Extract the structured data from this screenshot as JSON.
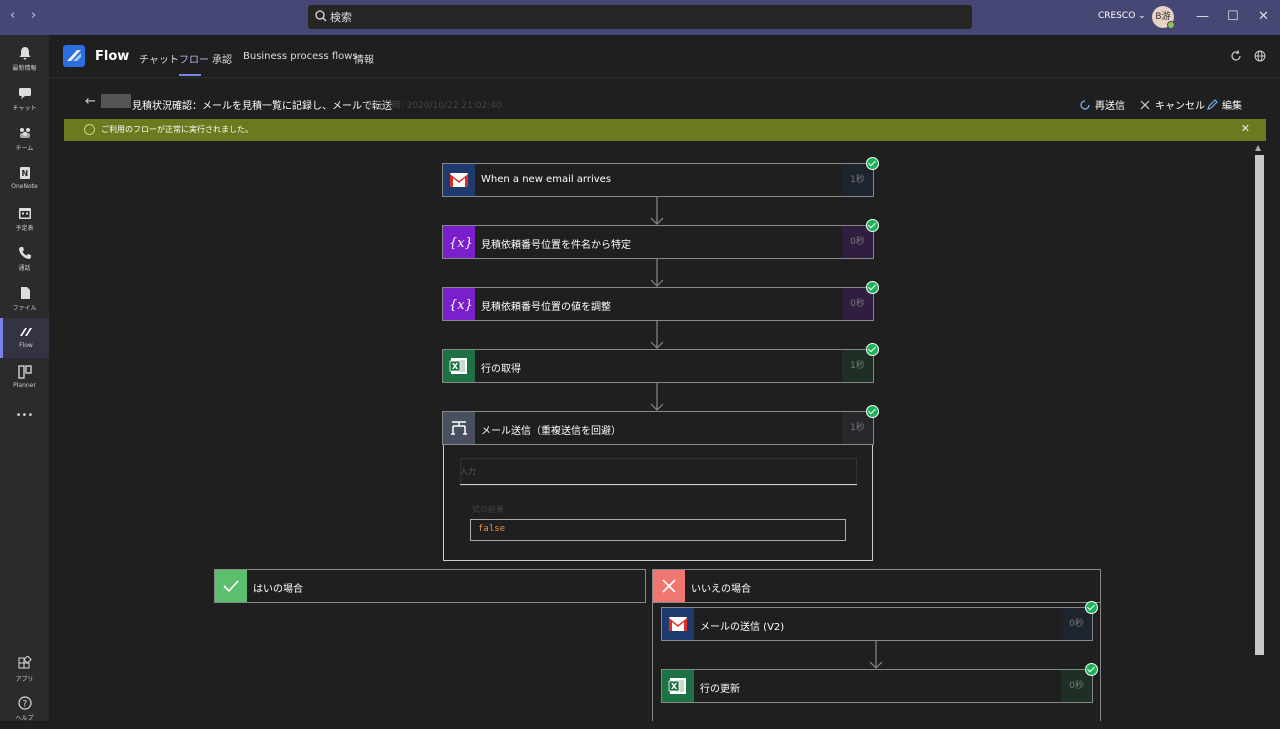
{
  "window": {
    "nav_back": "‹",
    "nav_forward": "›",
    "search_placeholder": "検索",
    "tenant": "CRESCO ⌄",
    "avatar_initials": "B游",
    "minimize": "—",
    "maximize": "☐",
    "close": "✕"
  },
  "rail": {
    "items": [
      {
        "label": "最新情報",
        "icon": "bell-icon"
      },
      {
        "label": "チャット",
        "icon": "chat-icon"
      },
      {
        "label": "チーム",
        "icon": "teams-icon"
      },
      {
        "label": "OneNote",
        "icon": "onenote-icon"
      },
      {
        "label": "予定表",
        "icon": "calendar-icon"
      },
      {
        "label": "通話",
        "icon": "phone-icon"
      },
      {
        "label": "ファイル",
        "icon": "file-icon"
      },
      {
        "label": "Flow",
        "icon": "flow-icon",
        "active": true
      },
      {
        "label": "Planner",
        "icon": "planner-icon"
      },
      {
        "label": "•••",
        "icon": "more-icon"
      }
    ],
    "bottom": [
      {
        "label": "アプリ",
        "icon": "apps-icon"
      },
      {
        "label": "ヘルプ",
        "icon": "help-icon"
      }
    ]
  },
  "app": {
    "name": "Flow",
    "tabs": [
      "チャット",
      "フロー",
      "承認",
      "Business process flows",
      "情報"
    ],
    "active_tab": "フロー"
  },
  "flow": {
    "title": "見積状況確認：メールを見積一覧に記録し、メールで転送",
    "run_time": "· 実行日時: 2020/10/22 21:02:40",
    "actions": {
      "resubmit": "再送信",
      "cancel": "キャンセル",
      "edit": "編集"
    }
  },
  "banner": {
    "message": "ご利用のフローが正常に実行されました。",
    "close": "✕"
  },
  "steps": [
    {
      "label": "When a new email arrives",
      "duration": "1秒",
      "icon": "gmail-icon",
      "color": "#1e3a6e"
    },
    {
      "label": "見積依頼番号位置を件名から特定",
      "duration": "0秒",
      "icon": "variable-icon",
      "color": "#7a1fcc"
    },
    {
      "label": "見積依頼番号位置の値を調整",
      "duration": "0秒",
      "icon": "variable-icon",
      "color": "#7a1fcc"
    },
    {
      "label": "行の取得",
      "duration": "1秒",
      "icon": "excel-icon",
      "color": "#1e7145"
    },
    {
      "label": "メール送信（重複送信を回避）",
      "duration": "1秒",
      "icon": "condition-icon",
      "color": "#484f5e"
    }
  ],
  "condition": {
    "input_label": "入力",
    "result_label": "式の結果",
    "result_value": "false"
  },
  "branches": {
    "yes": {
      "label": "はいの場合",
      "color": "#5cbf6e"
    },
    "no": {
      "label": "いいえの場合",
      "color": "#f07672"
    }
  },
  "no_steps": [
    {
      "label": "メールの送信 (V2)",
      "duration": "0秒",
      "icon": "gmail-icon",
      "color": "#1e3a6e"
    },
    {
      "label": "行の更新",
      "duration": "0秒",
      "icon": "excel-icon",
      "color": "#1e7145"
    }
  ]
}
